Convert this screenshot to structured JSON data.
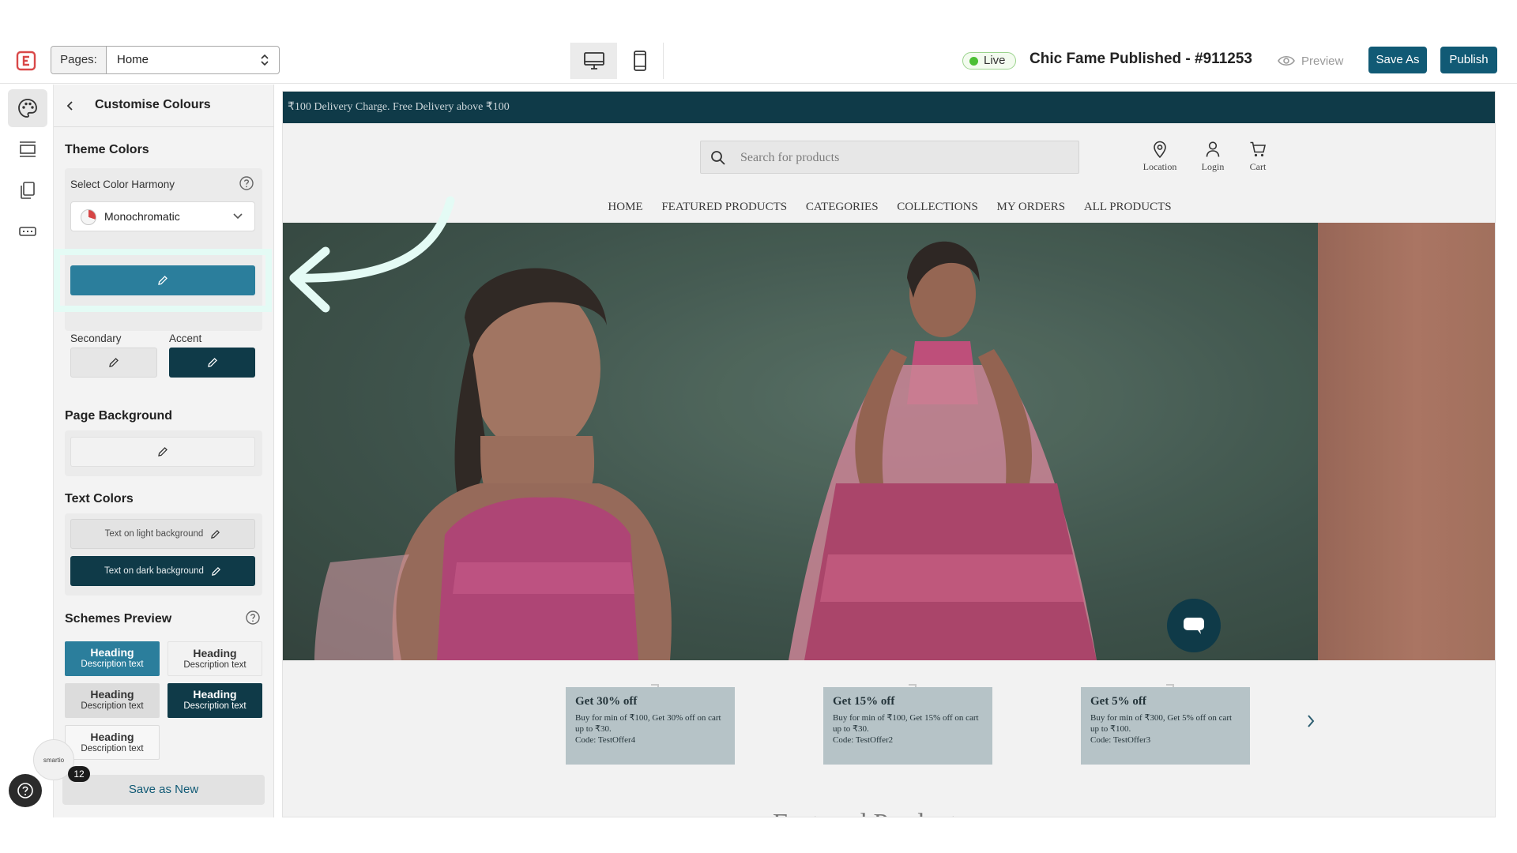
{
  "topbar": {
    "pages_label": "Pages:",
    "page_selected": "Home",
    "live_label": "Live",
    "site_title": "Chic Fame Published - #911253",
    "preview_label": "Preview",
    "save_as_label": "Save As",
    "publish_label": "Publish"
  },
  "rail": {
    "items": [
      "palette-icon",
      "sections-icon",
      "pages-icon",
      "components-icon"
    ]
  },
  "panel": {
    "title": "Customise Colours",
    "theme_colors": {
      "heading": "Theme Colors",
      "harmony_label": "Select Color Harmony",
      "harmony_value": "Monochromatic",
      "primary_color": "#2b7e9c",
      "secondary_label": "Secondary",
      "secondary_color": "#e6e6e6",
      "accent_label": "Accent",
      "accent_color": "#0f3a48"
    },
    "page_background": {
      "heading": "Page Background",
      "color": "#f2f2f2"
    },
    "text_colors": {
      "heading": "Text Colors",
      "light_label": "Text on light background",
      "dark_label": "Text on dark background"
    },
    "schemes_preview": {
      "heading": "Schemes Preview",
      "cards": [
        {
          "heading": "Heading",
          "description": "Description text",
          "bg": "#2b7e9c",
          "fg": "#ffffff"
        },
        {
          "heading": "Heading",
          "description": "Description text",
          "bg": "#f2f2f2",
          "fg": "#333333"
        },
        {
          "heading": "Heading",
          "description": "Description text",
          "bg": "#dcdcdc",
          "fg": "#333333"
        },
        {
          "heading": "Heading",
          "description": "Description text",
          "bg": "#0f3a48",
          "fg": "#ffffff"
        },
        {
          "heading": "Heading",
          "description": "Description text",
          "bg": "#f7f7f7",
          "fg": "#333333"
        }
      ]
    },
    "save_new_label": "Save as New"
  },
  "assistant": {
    "avatar_text": "smartio",
    "notification_count": "12"
  },
  "store": {
    "announcement": "₹100 Delivery Charge. Free Delivery above ₹100",
    "search_placeholder": "Search for products",
    "header_actions": [
      {
        "label": "Location",
        "icon": "location-pin-icon"
      },
      {
        "label": "Login",
        "icon": "user-icon"
      },
      {
        "label": "Cart",
        "icon": "cart-icon"
      }
    ],
    "nav": [
      "HOME",
      "FEATURED PRODUCTS",
      "CATEGORIES",
      "COLLECTIONS",
      "MY ORDERS",
      "ALL PRODUCTS"
    ],
    "offers": [
      {
        "title": "Get 30% off",
        "description": "Buy for min of ₹100, Get 30% off on cart up to ₹30.",
        "code": "Code: TestOffer4"
      },
      {
        "title": "Get 15% off",
        "description": "Buy for min of ₹100, Get 15% off on cart up to ₹30.",
        "code": "Code: TestOffer2"
      },
      {
        "title": "Get 5% off",
        "description": "Buy for min of ₹300, Get 5% off on cart up to ₹100.",
        "code": "Code: TestOffer3"
      }
    ],
    "next_section_peek": "Featured Products"
  }
}
